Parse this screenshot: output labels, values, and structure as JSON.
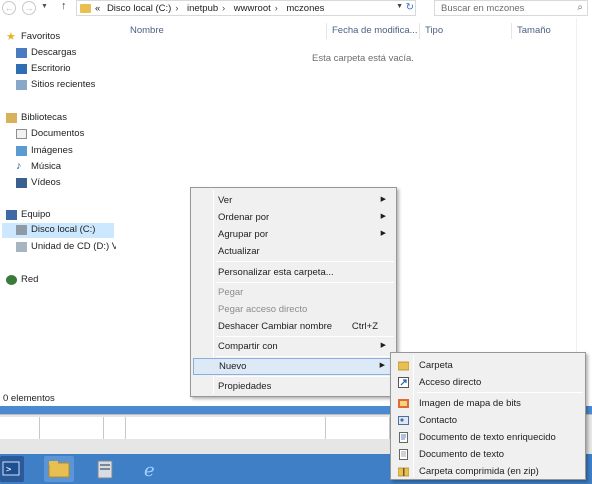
{
  "address_bar": {
    "prefix": "«",
    "crumbs": [
      "Disco local (C:)",
      "inetpub",
      "wwwroot",
      "mczones"
    ]
  },
  "search": {
    "placeholder": "Buscar en mczones"
  },
  "nav_pane": {
    "favorites": {
      "label": "Favoritos",
      "items": [
        "Descargas",
        "Escritorio",
        "Sitios recientes"
      ]
    },
    "libraries": {
      "label": "Bibliotecas",
      "items": [
        "Documentos",
        "Imágenes",
        "Música",
        "Vídeos"
      ]
    },
    "computer": {
      "label": "Equipo",
      "items": [
        "Disco local (C:)",
        "Unidad de CD (D:) V"
      ]
    },
    "network": {
      "label": "Red"
    }
  },
  "columns": [
    "Nombre",
    "Fecha de modifica...",
    "Tipo",
    "Tamaño"
  ],
  "empty_message": "Esta carpeta está vacía.",
  "status": {
    "items_count": "0 elementos"
  },
  "context_menu": {
    "items": [
      {
        "label": "Ver"
      },
      {
        "label": "Ordenar por"
      },
      {
        "label": "Agrupar por"
      },
      {
        "label": "Actualizar"
      },
      {
        "label": "Personalizar esta carpeta..."
      },
      {
        "label": "Pegar"
      },
      {
        "label": "Pegar acceso directo"
      },
      {
        "label": "Deshacer Cambiar nombre",
        "shortcut": "Ctrl+Z"
      },
      {
        "label": "Compartir con"
      },
      {
        "label": "Nuevo"
      },
      {
        "label": "Propiedades"
      }
    ]
  },
  "new_submenu": {
    "items": [
      {
        "label": "Carpeta",
        "icon": "folder-icon"
      },
      {
        "label": "Acceso directo",
        "icon": "shortcut-icon"
      },
      {
        "label": "Imagen de mapa de bits",
        "icon": "bitmap-icon"
      },
      {
        "label": "Contacto",
        "icon": "contact-icon"
      },
      {
        "label": "Documento de texto enriquecido",
        "icon": "rtf-icon"
      },
      {
        "label": "Documento de texto",
        "icon": "text-doc-icon"
      },
      {
        "label": "Carpeta comprimida (en zip)",
        "icon": "zip-folder-icon"
      }
    ]
  },
  "colors": {
    "accent": "#3e7fc6",
    "selection": "#cce8ff",
    "folder": "#e8c052"
  }
}
